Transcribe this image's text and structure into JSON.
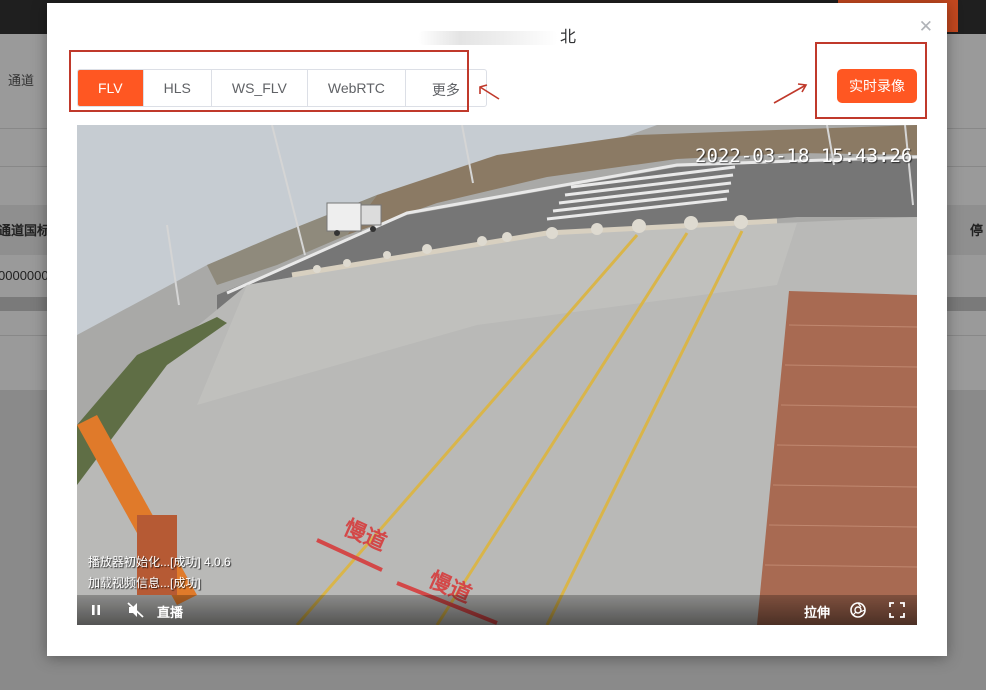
{
  "background": {
    "breadcrumb": "通道",
    "table_header_left": "通道国标",
    "table_header_right": "停",
    "table_cell_left": "0000000"
  },
  "modal": {
    "title": "北",
    "tabs": [
      {
        "label": "FLV",
        "active": true
      },
      {
        "label": "HLS",
        "active": false
      },
      {
        "label": "WS_FLV",
        "active": false
      },
      {
        "label": "WebRTC",
        "active": false
      },
      {
        "label": "更多",
        "active": false
      }
    ],
    "record_button": "实时录像",
    "close_icon": "close-icon"
  },
  "player": {
    "timestamp": "2022-03-18 15:43:26",
    "log_line_1": "播放器初始化...[成功] 4.0.6",
    "log_line_2": "加载视频信息...[成功]",
    "live_label": "直播",
    "stretch_label": "拉伸",
    "icons": [
      "pause-icon",
      "mute-icon",
      "screenshot-icon",
      "fullscreen-icon"
    ]
  },
  "colors": {
    "accent": "#ff5722",
    "highlight_box": "#c0392b",
    "overlay": "#8a8a8a"
  }
}
